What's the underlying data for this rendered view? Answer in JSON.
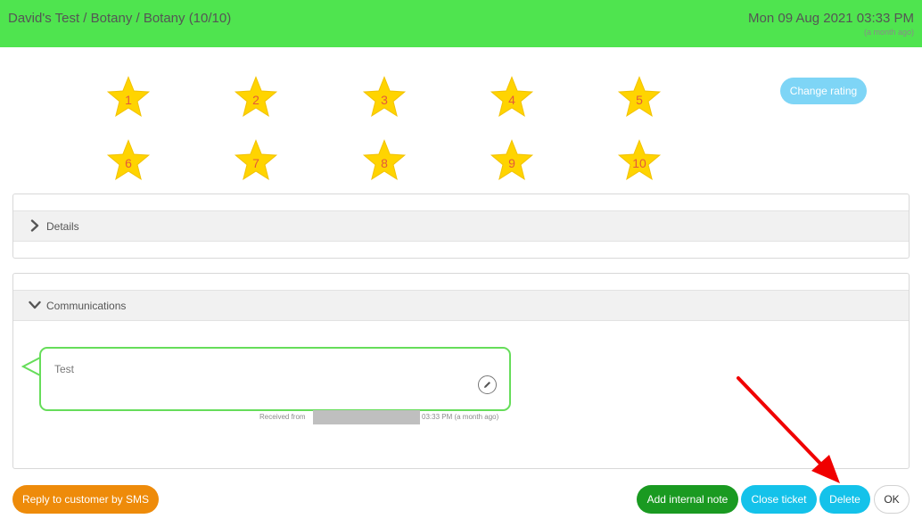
{
  "header": {
    "breadcrumb": "David's Test / Botany / Botany (10/10)",
    "datetime": "Mon 09 Aug 2021 03:33 PM",
    "relative_time": "(a month ago)",
    "background_color": "#4fe44f"
  },
  "rating": {
    "stars": [
      "1",
      "2",
      "3",
      "4",
      "5",
      "6",
      "7",
      "8",
      "9",
      "10"
    ],
    "star_color": "#ffd400",
    "number_color": "#e35a3a",
    "change_rating_label": "Change rating"
  },
  "details": {
    "title": "Details",
    "icon": "chevron-right-icon"
  },
  "communications": {
    "title": "Communications",
    "icon": "chevron-down-icon",
    "message": {
      "text": "Test",
      "received_prefix": "Received from",
      "received_suffix": "03:33 PM (a month ago)",
      "edit_icon": "pencil-icon"
    }
  },
  "actions": {
    "reply_sms": "Reply to customer by SMS",
    "add_note": "Add internal note",
    "close_ticket": "Close ticket",
    "delete": "Delete",
    "ok": "OK"
  }
}
